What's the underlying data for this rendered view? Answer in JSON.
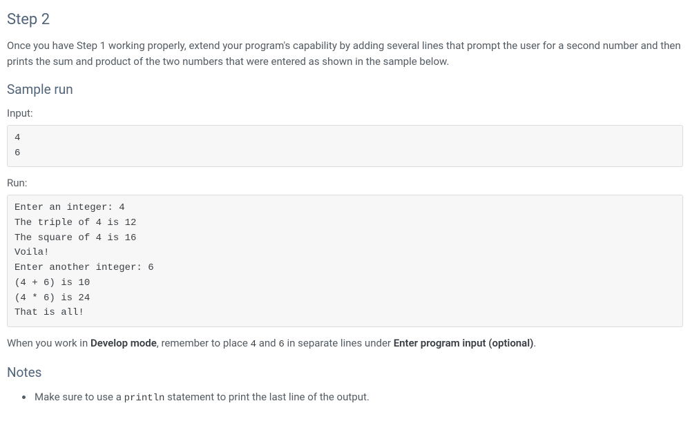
{
  "headings": {
    "step2": "Step 2",
    "sample_run": "Sample run",
    "notes": "Notes"
  },
  "paragraphs": {
    "step2_intro": "Once you have Step 1 working properly, extend your program's capability by adding several lines that prompt the user for a second number and then prints the sum and product of the two numbers that were entered as shown in the sample below.",
    "input_label": "Input:",
    "run_label": "Run:",
    "develop_note_prefix": "When you work in ",
    "develop_mode_strong": "Develop mode",
    "develop_note_mid1": ", remember to place ",
    "code_4": "4",
    "develop_note_mid2": " and ",
    "code_6": "6",
    "develop_note_mid3": " in separate lines under ",
    "enter_program_input_strong": "Enter program input (optional)",
    "develop_note_suffix": "."
  },
  "codeblocks": {
    "input_block": "4\n6",
    "run_block": "Enter an integer: 4\nThe triple of 4 is 12\nThe square of 4 is 16\nVoila!\nEnter another integer: 6\n(4 + 6) is 10\n(4 * 6) is 24\nThat is all!"
  },
  "notes": {
    "item1_prefix": "Make sure to use a ",
    "item1_code": "println",
    "item1_suffix": " statement to print the last line of the output."
  }
}
